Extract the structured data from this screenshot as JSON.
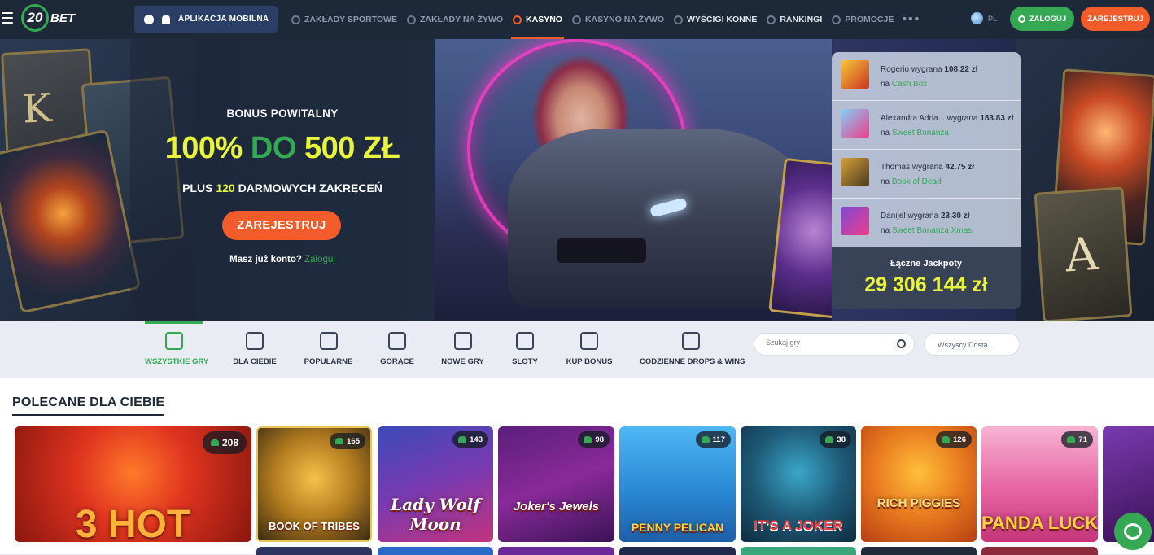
{
  "header": {
    "logo_number": "20",
    "logo_text": "BET",
    "app_button": "APLIKACJA MOBILNA",
    "nav": [
      {
        "label": "ZAKŁADY SPORTOWE",
        "icon": "soccer-ball-icon"
      },
      {
        "label": "ZAKŁADY NA ŻYWO",
        "icon": "live-betting-icon"
      },
      {
        "label": "KASYNO",
        "icon": "casino-chip-icon",
        "active": true
      },
      {
        "label": "KASYNO NA ŻYWO",
        "icon": "live-casino-icon"
      },
      {
        "label": "WYŚCIGI KONNE",
        "icon": "horse-icon"
      },
      {
        "label": "RANKINGI",
        "icon": "trophy-icon"
      },
      {
        "label": "PROMOCJE",
        "icon": "gift-icon"
      }
    ],
    "more": "•••",
    "language": "PL",
    "login_label": "ZALOGUJ",
    "register_label": "ZAREJESTRUJ"
  },
  "promo": {
    "subtitle": "BONUS POWITALNY",
    "headline_a": "100%",
    "headline_b": "DO",
    "headline_c": "500 ZŁ",
    "line_a": "PLUS",
    "line_b": "120",
    "line_c": "DARMOWYCH ZAKRĘCEŃ",
    "cta": "ZAREJESTRUJ",
    "account_question": "Masz już konto?",
    "account_link": "Zaloguj"
  },
  "winners": [
    {
      "name": "Rogerio",
      "won": "wygrana",
      "amount": "108.22 zł",
      "on": "na",
      "game": "Cash Box"
    },
    {
      "name": "Alexandra Adria...",
      "won": "wygrana",
      "amount": "183.83 zł",
      "on": "na",
      "game": "Sweet Bonanza"
    },
    {
      "name": "Thomas",
      "won": "wygrana",
      "amount": "42.75 zł",
      "on": "na",
      "game": "Book of Dead"
    },
    {
      "name": "Danijel",
      "won": "wygrana",
      "amount": "23.30 zł",
      "on": "na",
      "game": "Sweet Bonanza Xmas"
    }
  ],
  "jackpot": {
    "label": "Łączne Jackpoty",
    "value": "29 306 144 zł"
  },
  "categories": [
    {
      "label": "WSZYSTKIE GRY",
      "icon": "dice-icon",
      "active": true
    },
    {
      "label": "DLA CIEBIE",
      "icon": "user-heart-icon"
    },
    {
      "label": "POPULARNE",
      "icon": "crown-icon"
    },
    {
      "label": "GORĄCE",
      "icon": "chili-icon"
    },
    {
      "label": "NOWE GRY",
      "icon": "star-icon"
    },
    {
      "label": "SLOTY",
      "icon": "cherry-icon"
    },
    {
      "label": "KUP BONUS",
      "icon": "money-bag-icon"
    },
    {
      "label": "CODZIENNE DROPS & WINS",
      "icon": "drops-wins-icon"
    }
  ],
  "search": {
    "placeholder": "Szukaj gry"
  },
  "provider": {
    "label": "Wszyscy Dosta..."
  },
  "section": {
    "title": "POLECANE DLA CIEBIE"
  },
  "games": [
    {
      "name": "3 HOT",
      "players": "208"
    },
    {
      "name": "BOOK OF TRIBES",
      "players": "165"
    },
    {
      "name": "Lady Wolf Moon",
      "players": "143"
    },
    {
      "name": "Joker's Jewels",
      "players": "98"
    },
    {
      "name": "PENNY PELICAN",
      "players": "117"
    },
    {
      "name": "IT'S A JOKER",
      "players": "38"
    },
    {
      "name": "RICH PIGGIES",
      "players": "126"
    },
    {
      "name": "PANDA LUCK",
      "players": "71"
    }
  ],
  "colors": {
    "header_bg": "#1d2838",
    "accent_orange": "#f25b2a",
    "accent_green": "#34a853",
    "highlight_yellow": "#e9f53a"
  }
}
